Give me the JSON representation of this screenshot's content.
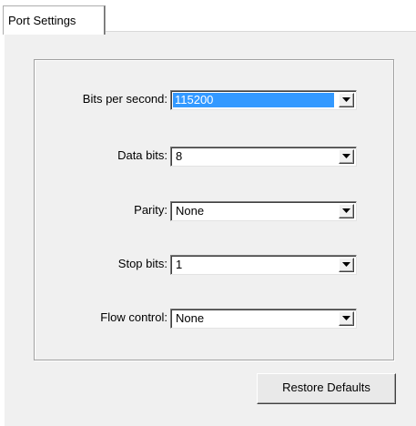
{
  "tab": {
    "label": "Port Settings"
  },
  "fields": [
    {
      "label": "Bits per second:",
      "value": "115200",
      "selected": true,
      "icon": "chevron-down-icon"
    },
    {
      "label": "Data bits:",
      "value": "8",
      "selected": false,
      "icon": "chevron-down-icon"
    },
    {
      "label": "Parity:",
      "value": "None",
      "selected": false,
      "icon": "chevron-down-icon"
    },
    {
      "label": "Stop bits:",
      "value": "1",
      "selected": false,
      "icon": "chevron-down-icon"
    },
    {
      "label": "Flow control:",
      "value": "None",
      "selected": false,
      "icon": "chevron-down-icon"
    }
  ],
  "buttons": {
    "restore_defaults": "Restore Defaults"
  },
  "colors": {
    "selection_bg": "#3399ff",
    "selection_text": "#ffffff",
    "page_bg": "#f0f0f0"
  }
}
